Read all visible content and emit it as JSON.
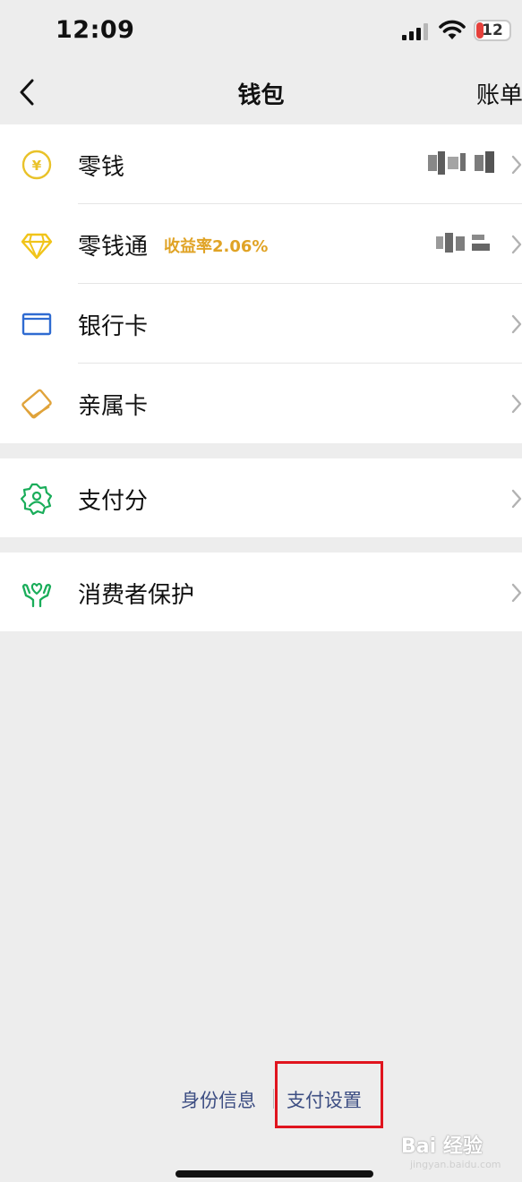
{
  "status_bar": {
    "time": "12:09",
    "battery": "12",
    "icons": [
      "cellular-signal-icon",
      "wifi-icon",
      "battery-icon"
    ]
  },
  "nav": {
    "title": "钱包",
    "right": "账单",
    "back_icon": "chevron-left-icon"
  },
  "wallet_items": [
    {
      "label": "零钱",
      "icon": "yuan-coin-icon",
      "amount": "masked"
    },
    {
      "label": "零钱通",
      "badge": "收益率2.06%",
      "icon": "diamond-icon",
      "amount": "masked"
    },
    {
      "label": "银行卡",
      "icon": "bank-card-icon"
    },
    {
      "label": "亲属卡",
      "icon": "family-card-icon"
    }
  ],
  "score_item": {
    "label": "支付分",
    "icon": "pay-score-icon"
  },
  "protection_item": {
    "label": "消费者保护",
    "icon": "protection-hands-icon"
  },
  "footer": {
    "identity": "身份信息",
    "settings": "支付设置"
  },
  "watermark": {
    "text": "Bai 经验",
    "sub": "jingyan.baidu.com"
  },
  "colors": {
    "accent_gold": "#e0a325",
    "link_blue": "#3d4e83",
    "bank_blue": "#2f6bd1",
    "green": "#1aad5a",
    "highlight_red": "#e0141e"
  }
}
